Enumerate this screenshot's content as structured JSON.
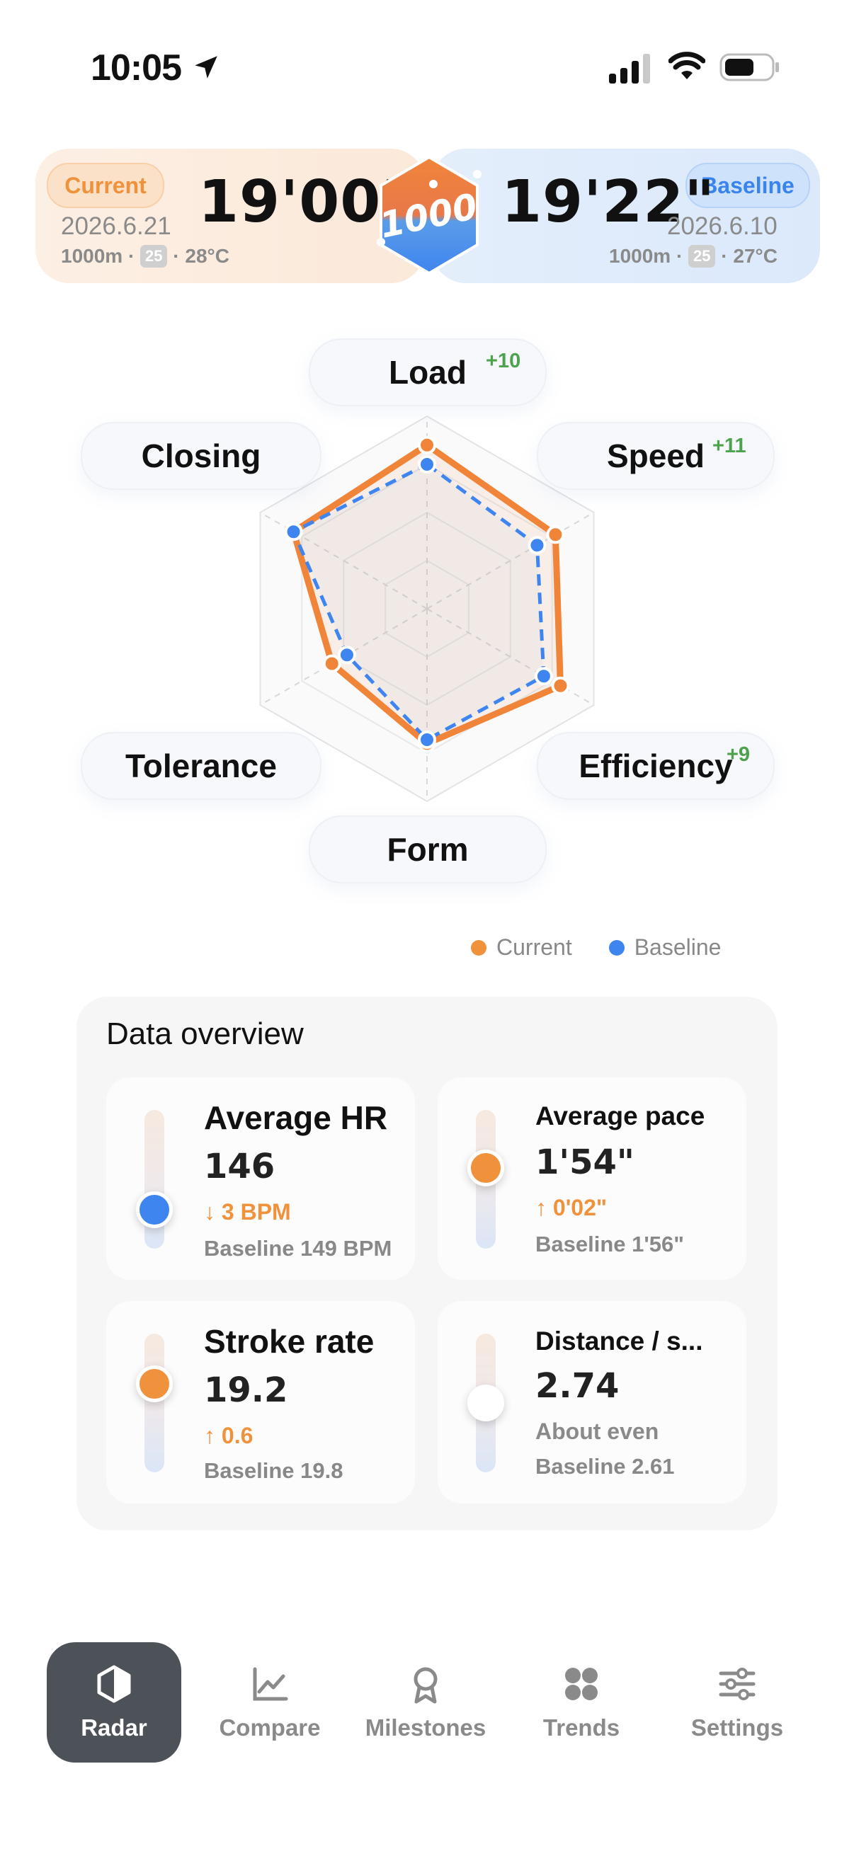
{
  "status": {
    "time": "10:05"
  },
  "header": {
    "current": {
      "tag": "Current",
      "time": "19'00\"",
      "date": "2026.6.21",
      "distance": "1000m ·",
      "lane_badge": "25",
      "temp": "· 28°C"
    },
    "baseline": {
      "tag": "Baseline",
      "time": "19'22\"",
      "date": "2026.6.10",
      "distance": "1000m ·",
      "lane_badge": "25",
      "temp": "· 27°C"
    },
    "logo_text": "1000"
  },
  "radar": {
    "axes": [
      {
        "label": "Load",
        "delta": "+10"
      },
      {
        "label": "Speed",
        "delta": "+11"
      },
      {
        "label": "Efficiency",
        "delta": "+9"
      },
      {
        "label": "Form",
        "delta": ""
      },
      {
        "label": "Tolerance",
        "delta": ""
      },
      {
        "label": "Closing",
        "delta": ""
      }
    ]
  },
  "chart_data": {
    "type": "radar",
    "axes": [
      "Load",
      "Speed",
      "Efficiency",
      "Form",
      "Tolerance",
      "Closing"
    ],
    "range": [
      0,
      100
    ],
    "series": [
      {
        "name": "Current",
        "color": "#f0853a",
        "values": [
          85,
          77,
          80,
          70,
          57,
          80
        ]
      },
      {
        "name": "Baseline",
        "color": "#3e85f0",
        "values": [
          75,
          66,
          70,
          68,
          48,
          80
        ]
      }
    ]
  },
  "legend": {
    "current": "Current",
    "baseline": "Baseline"
  },
  "overview": {
    "title": "Data overview",
    "metrics": [
      {
        "name": "Average HR",
        "value": "146",
        "delta": "↓ 3 BPM",
        "baseline": "Baseline 149 BPM",
        "knob_color": "#3e85f0",
        "level": 0.72
      },
      {
        "name": "Average pace",
        "value": "1'54\"",
        "delta": "↑ 0'02\"",
        "baseline": "Baseline 1'56\"",
        "knob_color": "#f0913c",
        "level": 0.42
      },
      {
        "name": "Stroke rate",
        "value": "19.2",
        "delta": "↑ 0.6",
        "baseline": "Baseline 19.8",
        "knob_color": "#f0913c",
        "level": 0.36
      },
      {
        "name": "Distance / s...",
        "value": "2.74",
        "delta": "About even",
        "baseline": "Baseline 2.61",
        "knob_color": "#ffffff",
        "level": 0.5
      }
    ]
  },
  "tabs": [
    {
      "label": "Radar",
      "icon": "radar-hex-icon",
      "active": true
    },
    {
      "label": "Compare",
      "icon": "chart-line-icon",
      "active": false
    },
    {
      "label": "Milestones",
      "icon": "medal-icon",
      "active": false
    },
    {
      "label": "Trends",
      "icon": "grid-dots-icon",
      "active": false
    },
    {
      "label": "Settings",
      "icon": "sliders-icon",
      "active": false
    }
  ]
}
